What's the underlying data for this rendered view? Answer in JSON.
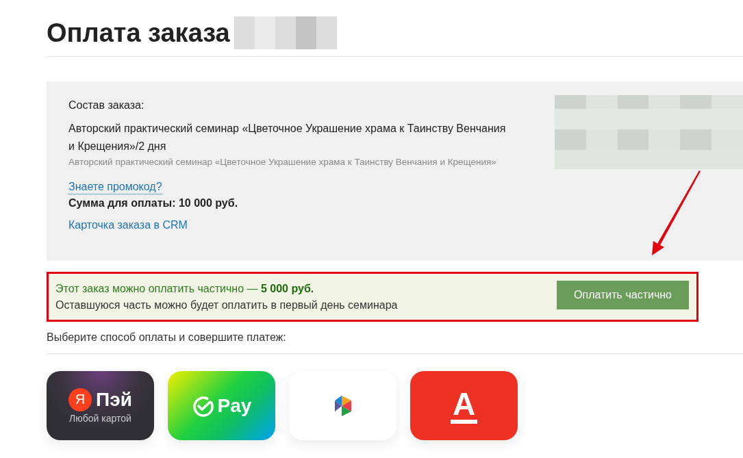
{
  "title": "Оплата заказа",
  "order": {
    "heading": "Состав заказа:",
    "item_title": "Авторский практический семинар «Цветочное Украшение храма к Таинству Венчания и Крещения»/2 дня",
    "item_description": "Авторский практический семинар «Цветочное Украшение храма к Таинству Венчания и Крещения»",
    "promo_link": "Знаете промокод?",
    "total": "Сумма для оплаты: 10 000 руб.",
    "crm_link": "Карточка заказа в CRM"
  },
  "partial_payment": {
    "text": "Этот заказ можно оплатить частично — **5 000 руб.**",
    "note": "Оставшуюся часть можно будет оплатить в первый день семинара",
    "button": "Оплатить частично"
  },
  "payment_prompt": "Выберите способ оплаты и совершите платеж:",
  "payment_methods": [
    {
      "kind": "yandex",
      "badge": "Я",
      "label": "Пэй",
      "caption": "Любой картой"
    },
    {
      "kind": "sber",
      "label": "Pay"
    },
    {
      "kind": "sbp"
    },
    {
      "kind": "alfa",
      "label": "А"
    }
  ]
}
